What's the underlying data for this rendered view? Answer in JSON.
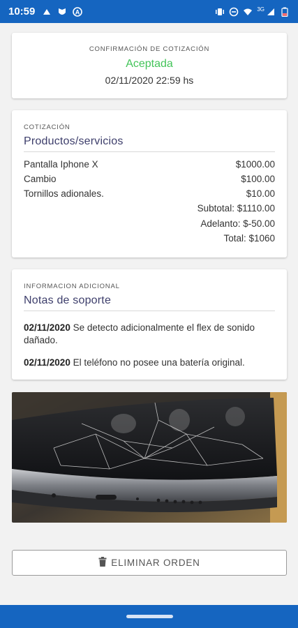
{
  "status_bar": {
    "time": "10:59",
    "network": "3G",
    "left_icons": [
      "cast-icon",
      "shield-icon",
      "a-circle-icon"
    ],
    "right_icons": [
      "vibrate-icon",
      "dnd-icon",
      "wifi-icon",
      "signal-icon",
      "battery-low-icon"
    ],
    "color": "#1565c0"
  },
  "confirmation": {
    "caption": "CONFIRMACIÓN DE COTIZACIÓN",
    "status": "Aceptada",
    "status_color": "#43c459",
    "datetime": "02/11/2020 22:59 hs"
  },
  "quote": {
    "caption": "COTIZACIÓN",
    "title": "Productos/servicios",
    "items": [
      {
        "name": "Pantalla Iphone X",
        "price": "$1000.00"
      },
      {
        "name": "Cambio",
        "price": "$100.00"
      },
      {
        "name": "Tornillos adionales.",
        "price": "$10.00"
      }
    ],
    "subtotal": "Subtotal: $1110.00",
    "advance": "Adelanto: $-50.00",
    "total": "Total: $1060"
  },
  "notes": {
    "caption": "INFORMACION ADICIONAL",
    "title": "Notas de soporte",
    "entries": [
      {
        "date": "02/11/2020",
        "text": " Se detecto adicionalmente el flex de sonido dañado."
      },
      {
        "date": "02/11/2020",
        "text": " El teléfono no posee una batería original."
      }
    ]
  },
  "photo": {
    "icon": "broken-phone-photo"
  },
  "actions": {
    "delete_label": "ELIMINAR ORDEN",
    "delete_icon": "trash-icon"
  }
}
